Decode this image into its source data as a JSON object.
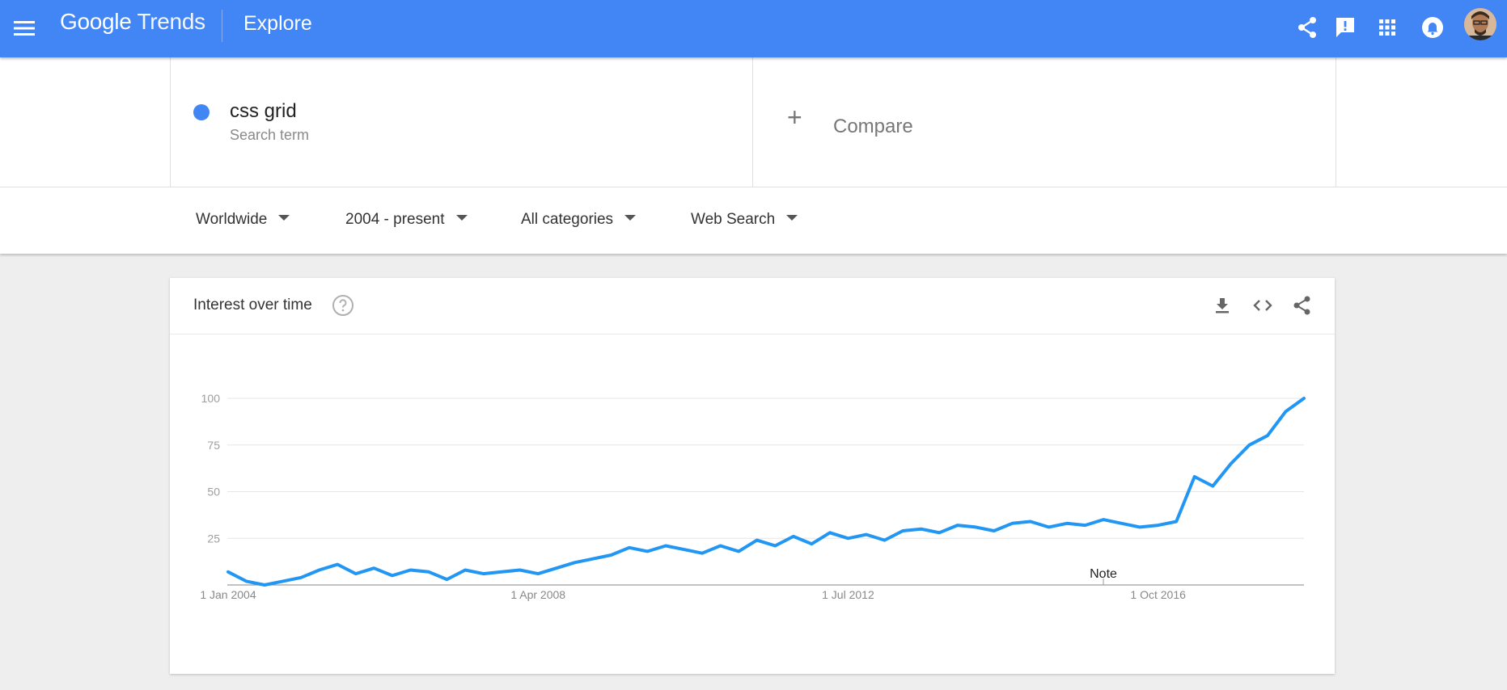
{
  "header": {
    "logo_google": "Google",
    "logo_trends": "Trends",
    "page_title": "Explore",
    "icons": [
      "menu-icon",
      "share-icon",
      "feedback-icon",
      "apps-icon",
      "notifications-icon",
      "avatar"
    ],
    "color": "#4285f4"
  },
  "search": {
    "term": "css grid",
    "term_type": "Search term",
    "term_color": "#4285f4",
    "compare_label": "Compare"
  },
  "filters": {
    "region": "Worldwide",
    "time_range": "2004 - present",
    "category": "All categories",
    "property": "Web Search"
  },
  "card": {
    "title": "Interest over time",
    "icons": [
      "help-icon",
      "download-icon",
      "embed-icon",
      "share-icon"
    ]
  },
  "chart_data": {
    "type": "line",
    "title": "",
    "xlabel": "",
    "ylabel": "",
    "ylim": [
      0,
      100
    ],
    "yticks": [
      "25",
      "50",
      "75",
      "100"
    ],
    "ytick_values": [
      25,
      50,
      75,
      100
    ],
    "xtick_labels": [
      "1 Jan 2004",
      "1 Apr 2008",
      "1 Jul 2012",
      "1 Oct 2016"
    ],
    "xtick_dates": [
      "2004-01",
      "2008-04",
      "2012-07",
      "2016-10"
    ],
    "x_range": [
      "2004-01",
      "2018-10"
    ],
    "grid": true,
    "legend": "none",
    "annotations": [
      {
        "label": "Note",
        "x": "2016-01"
      }
    ],
    "series": [
      {
        "color": "#2196f3",
        "points": [
          [
            "2004-01",
            7
          ],
          [
            "2004-04",
            2
          ],
          [
            "2004-07",
            0
          ],
          [
            "2004-10",
            2
          ],
          [
            "2005-01",
            4
          ],
          [
            "2005-04",
            8
          ],
          [
            "2005-07",
            11
          ],
          [
            "2005-10",
            6
          ],
          [
            "2006-01",
            9
          ],
          [
            "2006-04",
            5
          ],
          [
            "2006-07",
            8
          ],
          [
            "2006-10",
            7
          ],
          [
            "2007-01",
            3
          ],
          [
            "2007-04",
            8
          ],
          [
            "2007-07",
            6
          ],
          [
            "2007-10",
            7
          ],
          [
            "2008-01",
            8
          ],
          [
            "2008-04",
            6
          ],
          [
            "2008-07",
            9
          ],
          [
            "2008-10",
            12
          ],
          [
            "2009-01",
            14
          ],
          [
            "2009-04",
            16
          ],
          [
            "2009-07",
            20
          ],
          [
            "2009-10",
            18
          ],
          [
            "2010-01",
            21
          ],
          [
            "2010-04",
            19
          ],
          [
            "2010-07",
            17
          ],
          [
            "2010-10",
            21
          ],
          [
            "2011-01",
            18
          ],
          [
            "2011-04",
            24
          ],
          [
            "2011-07",
            21
          ],
          [
            "2011-10",
            26
          ],
          [
            "2012-01",
            22
          ],
          [
            "2012-04",
            28
          ],
          [
            "2012-07",
            25
          ],
          [
            "2012-10",
            27
          ],
          [
            "2013-01",
            24
          ],
          [
            "2013-04",
            29
          ],
          [
            "2013-07",
            30
          ],
          [
            "2013-10",
            28
          ],
          [
            "2014-01",
            32
          ],
          [
            "2014-04",
            31
          ],
          [
            "2014-07",
            29
          ],
          [
            "2014-10",
            33
          ],
          [
            "2015-01",
            34
          ],
          [
            "2015-04",
            31
          ],
          [
            "2015-07",
            33
          ],
          [
            "2015-10",
            32
          ],
          [
            "2016-01",
            35
          ],
          [
            "2016-04",
            33
          ],
          [
            "2016-07",
            31
          ],
          [
            "2016-10",
            32
          ],
          [
            "2017-01",
            34
          ],
          [
            "2017-04",
            58
          ],
          [
            "2017-07",
            53
          ],
          [
            "2017-10",
            65
          ],
          [
            "2018-01",
            75
          ],
          [
            "2018-04",
            80
          ],
          [
            "2018-07",
            93
          ],
          [
            "2018-10",
            100
          ]
        ]
      }
    ]
  }
}
